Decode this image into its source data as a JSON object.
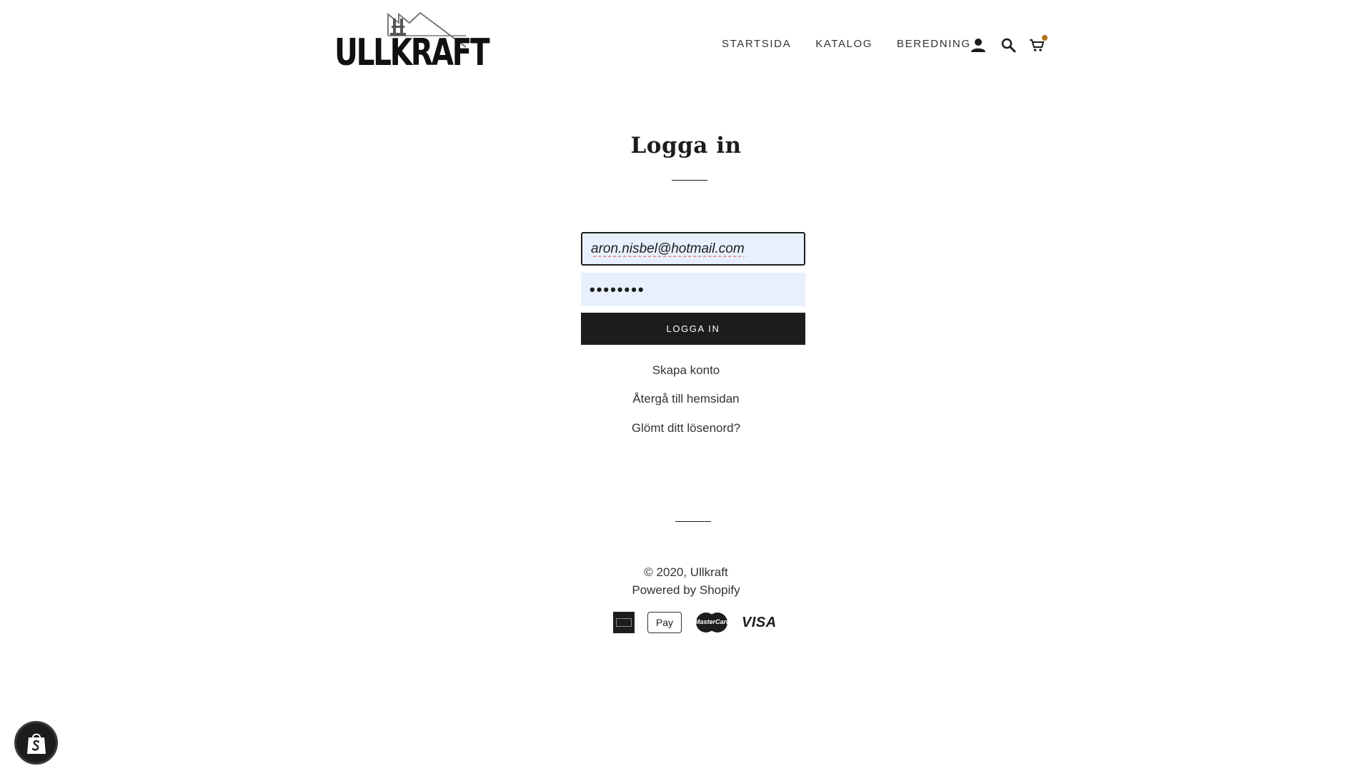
{
  "brand": {
    "logo_text": "ULLKRAFT"
  },
  "nav": {
    "items": [
      "STARTSIDA",
      "KATALOG",
      "BEREDNING"
    ],
    "icons": [
      "account-icon",
      "search-icon",
      "cart-icon"
    ],
    "cart_indicator_color": "#b3701e"
  },
  "login": {
    "title": "Logga in",
    "email_value": "aron.nisbel@hotmail.com",
    "password_value": "••••••••",
    "submit_label": "LOGGA IN",
    "create_account_link": "Skapa konto",
    "return_home_link": "Återgå till hemsidan",
    "forgot_password_link": "Glömt ditt lösenord?"
  },
  "footer": {
    "copyright": "© 2020, Ullkraft",
    "powered_by": "Powered by Shopify",
    "payment_methods": [
      "american-express-icon",
      "apple-pay-icon",
      "mastercard-icon",
      "visa-icon"
    ],
    "applepay_label": " Pay",
    "mastercard_label": "MasterCard",
    "visa_label": "VISA"
  },
  "colors": {
    "button_bg": "#1c1d1d",
    "field_bg": "#e8f0fe",
    "text": "#1c1d1d"
  }
}
